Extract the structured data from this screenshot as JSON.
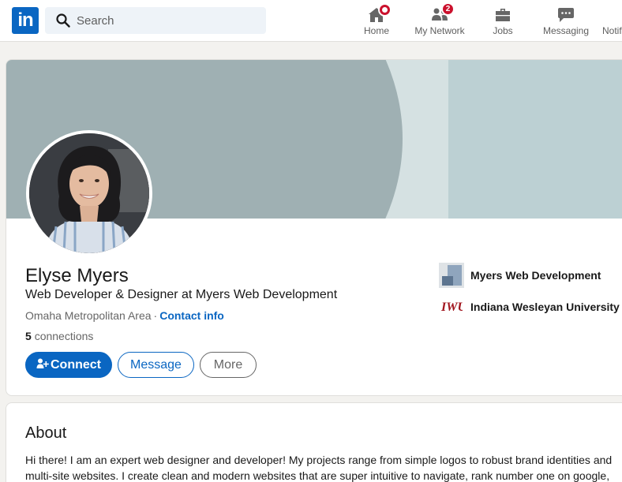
{
  "nav": {
    "search_placeholder": "Search",
    "items": [
      {
        "label": "Home",
        "icon": "home-icon",
        "badge": ""
      },
      {
        "label": "My Network",
        "icon": "network-icon",
        "badge": "2"
      },
      {
        "label": "Jobs",
        "icon": "briefcase-icon",
        "badge": ""
      },
      {
        "label": "Messaging",
        "icon": "message-icon",
        "badge": ""
      },
      {
        "label": "Notifi",
        "icon": "bell-icon",
        "badge": ""
      }
    ],
    "logo_text": "in"
  },
  "profile": {
    "name": "Elyse Myers",
    "headline": "Web Developer & Designer at Myers Web Development",
    "location": "Omaha Metropolitan Area",
    "separator": "·",
    "contact_info": "Contact info",
    "connections_count": "5",
    "connections_label": "connections",
    "buttons": {
      "connect": "Connect",
      "message": "Message",
      "more": "More"
    },
    "orgs": [
      {
        "name": "Myers Web Development"
      },
      {
        "name": "Indiana Wesleyan University",
        "logo_text": "IWU"
      }
    ]
  },
  "about": {
    "title": "About",
    "text": "Hi there! I am an expert web designer and developer! My projects range from simple logos to robust brand identities and multi-site websites. I create clean and modern websites that are super intuitive to navigate, rank number one on google,"
  },
  "colors": {
    "brand": "#0a66c2",
    "badge": "#cb112d",
    "banner_dark": "#9fb0b3",
    "banner_light": "#bcd0d3"
  }
}
